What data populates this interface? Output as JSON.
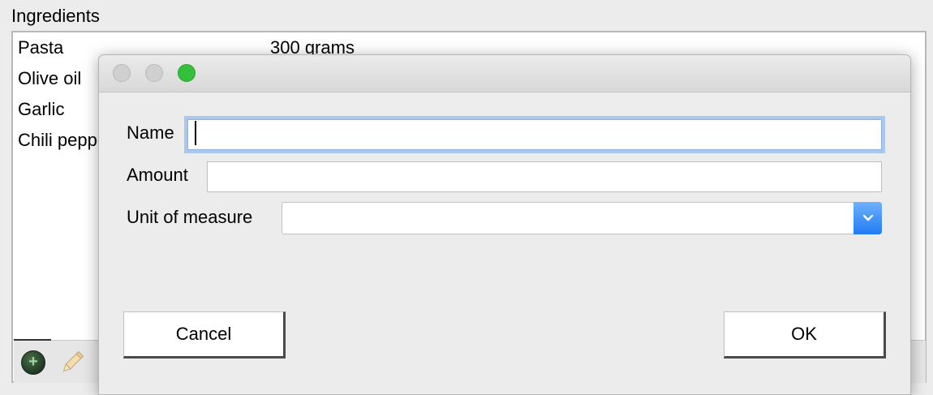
{
  "panel": {
    "title": "Ingredients",
    "ingredients": [
      {
        "name": "Pasta",
        "amount": "300 grams"
      },
      {
        "name": "Olive oil",
        "amount": ""
      },
      {
        "name": "Garlic",
        "amount": ""
      },
      {
        "name": "Chili pepper",
        "amount": ""
      }
    ],
    "toolbar": {
      "add_icon": "plus-circle",
      "edit_icon": "pencil"
    }
  },
  "dialog": {
    "fields": {
      "name_label": "Name",
      "name_value": "",
      "amount_label": "Amount",
      "amount_value": "",
      "unit_label": "Unit of measure",
      "unit_value": ""
    },
    "buttons": {
      "cancel": "Cancel",
      "ok": "OK"
    },
    "colors": {
      "accent": "#1f7cf4",
      "focus_ring": "#a8c8f0",
      "zoom_button": "#35c03b"
    }
  }
}
